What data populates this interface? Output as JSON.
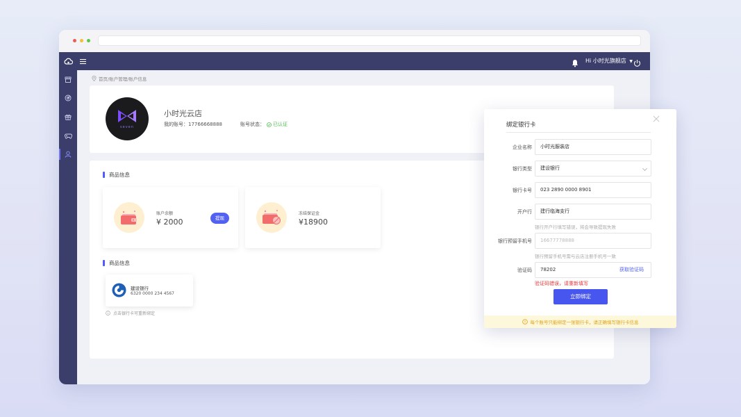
{
  "header": {
    "greeting": "Hi 小时光旗舰店"
  },
  "breadcrumb": "首页/账户管理/账户信息",
  "profile": {
    "avatar_text": "seven",
    "store_name": "小时光云店",
    "account_label": "我的账号：",
    "account_value": "17766668888",
    "status_label": "账号状态：",
    "status_value": "已认证"
  },
  "goods_section": {
    "title": "商品信息",
    "balance": {
      "label": "账户余额",
      "value": "¥ 2000",
      "button": "提现"
    },
    "deposit": {
      "label": "冻结保证金",
      "value": "¥18900"
    }
  },
  "bank_section": {
    "title": "商品信息",
    "card": {
      "name": "建设银行",
      "number": "6320 0000 234 4567"
    },
    "tip": "点击银行卡可重新绑定"
  },
  "dialog": {
    "title": "绑定银行卡",
    "fields": {
      "company_label": "企业名称",
      "company_value": "小时光服装店",
      "bank_type_label": "银行类型",
      "bank_type_value": "建设银行",
      "card_no_label": "银行卡号",
      "card_no_value": "023 2890 0000 8901",
      "branch_label": "开户行",
      "branch_value": "建行临海支行",
      "branch_hint": "银行开户行填写错误，将会导致提现失败",
      "phone_label": "银行预留手机号",
      "phone_placeholder": "16677778888",
      "phone_hint": "银行预留手机号需与云店注册手机号一致",
      "code_label": "验证码",
      "code_value": "78202",
      "get_code": "获取验证码",
      "code_error": "验证码错误，请重新填写"
    },
    "submit": "立即绑定",
    "footer": "每个账号只能绑定一张银行卡，请正确填写银行卡信息"
  },
  "colors": {
    "nav_bg": "#3b3d6a",
    "accent": "#4856f0",
    "success": "#4cc14f",
    "error": "#e4393c",
    "warning": "#e3a10f"
  }
}
